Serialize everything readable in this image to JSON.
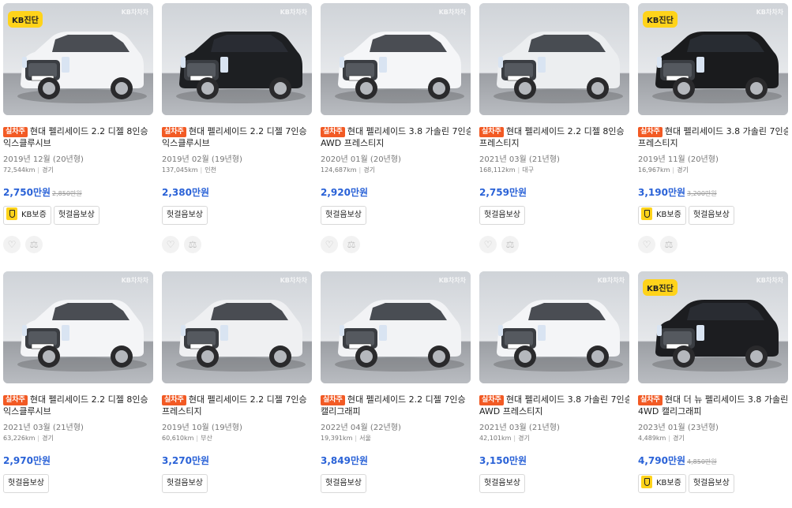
{
  "listings": [
    {
      "tag": "실차주",
      "title1": "현대 펠리세이드 2.2 디젤 8인승",
      "title2": "익스클루시브",
      "year": "2019년 12월 (20년형)",
      "mileage": "72,544km",
      "region": "경기",
      "price": "2,750만원",
      "old_price": "2,850만원",
      "kb_badge": "KB진단",
      "watermark": "KB차차차",
      "car_color": "#f3f4f6",
      "kb_warranty": "KB보증",
      "compensation": "헛걸음보상",
      "show_actions": true
    },
    {
      "tag": "실차주",
      "title1": "현대 펠리세이드 2.2 디젤 7인승",
      "title2": "익스클루시브",
      "year": "2019년 02월 (19년형)",
      "mileage": "137,045km",
      "region": "인천",
      "price": "2,380만원",
      "old_price": "",
      "kb_badge": "",
      "watermark": "KB차차차",
      "car_color": "#1d1f22",
      "kb_warranty": "",
      "compensation": "헛걸음보상",
      "show_actions": true
    },
    {
      "tag": "실차주",
      "title1": "현대 펠리세이드 3.8 가솔린 7인승",
      "title2": "AWD 프레스티지",
      "year": "2020년 01월 (20년형)",
      "mileage": "124,687km",
      "region": "경기",
      "price": "2,920만원",
      "old_price": "",
      "kb_badge": "",
      "watermark": "KB차차차",
      "car_color": "#f5f6f8",
      "kb_warranty": "",
      "compensation": "헛걸음보상",
      "show_actions": true
    },
    {
      "tag": "실차주",
      "title1": "현대 펠리세이드 2.2 디젤 8인승",
      "title2": "프레스티지",
      "year": "2021년 03월 (21년형)",
      "mileage": "168,112km",
      "region": "대구",
      "price": "2,759만원",
      "old_price": "",
      "kb_badge": "",
      "watermark": "",
      "car_color": "#eceef0",
      "kb_warranty": "",
      "compensation": "헛걸음보상",
      "show_actions": true
    },
    {
      "tag": "실차주",
      "title1": "현대 펠리세이드 3.8 가솔린 7인승",
      "title2": "프레스티지",
      "year": "2019년 11월 (20년형)",
      "mileage": "16,967km",
      "region": "경기",
      "price": "3,190만원",
      "old_price": "3,200만원",
      "kb_badge": "KB진단",
      "watermark": "KB차차차",
      "car_color": "#1a1b1d",
      "kb_warranty": "KB보증",
      "compensation": "헛걸음보상",
      "show_actions": true
    },
    {
      "tag": "실차주",
      "title1": "현대 펠리세이드 2.2 디젤 8인승",
      "title2": "익스클루시브",
      "year": "2021년 03월 (21년형)",
      "mileage": "63,226km",
      "region": "경기",
      "price": "2,970만원",
      "old_price": "",
      "kb_badge": "",
      "watermark": "KB차차차",
      "car_color": "#f4f5f7",
      "kb_warranty": "",
      "compensation": "헛걸음보상",
      "show_actions": false
    },
    {
      "tag": "실차주",
      "title1": "현대 펠리세이드 2.2 디젤 7인승",
      "title2": "프레스티지",
      "year": "2019년 10월 (19년형)",
      "mileage": "60,610km",
      "region": "부산",
      "price": "3,270만원",
      "old_price": "",
      "kb_badge": "",
      "watermark": "KB차차차",
      "car_color": "#eff0f2",
      "kb_warranty": "",
      "compensation": "헛걸음보상",
      "show_actions": false
    },
    {
      "tag": "실차주",
      "title1": "현대 펠리세이드 2.2 디젤 7인승",
      "title2": "캘리그래피",
      "year": "2022년 04월 (22년형)",
      "mileage": "19,391km",
      "region": "서울",
      "price": "3,849만원",
      "old_price": "",
      "kb_badge": "",
      "watermark": "KB차차차",
      "car_color": "#f2f3f5",
      "kb_warranty": "",
      "compensation": "헛걸음보상",
      "show_actions": false
    },
    {
      "tag": "실차주",
      "title1": "현대 펠리세이드 3.8 가솔린 7인승",
      "title2": "AWD 프레스티지",
      "year": "2021년 03월 (21년형)",
      "mileage": "42,101km",
      "region": "경기",
      "price": "3,150만원",
      "old_price": "",
      "kb_badge": "",
      "watermark": "KB차차차",
      "car_color": "#f4f5f7",
      "kb_warranty": "",
      "compensation": "헛걸음보상",
      "show_actions": false
    },
    {
      "tag": "실차주",
      "title1": "현대 더 뉴 펠리세이드 3.8 가솔린",
      "title2": "4WD 캘리그래피",
      "year": "2023년 01월 (23년형)",
      "mileage": "4,489km",
      "region": "경기",
      "price": "4,790만원",
      "old_price": "4,850만원",
      "kb_badge": "KB진단",
      "watermark": "KB차차차",
      "car_color": "#1c1d20",
      "kb_warranty": "KB보증",
      "compensation": "헛걸음보상",
      "show_actions": false
    }
  ],
  "icons": {
    "like": "heart-icon",
    "compare": "scale-icon"
  },
  "colors": {
    "price": "#2a62d7",
    "tag": "#f25a24",
    "kb_yellow": "#ffd31a"
  }
}
